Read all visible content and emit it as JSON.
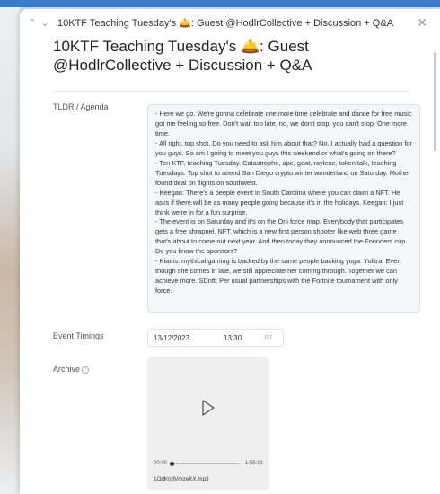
{
  "header": {
    "title": "10KTF Teaching Tuesday's 🛎️: Guest @HodlrCollective + Discussion + Q&A",
    "prev_icon": "chevron-up-icon",
    "next_icon": "chevron-down-icon",
    "close_icon": "close-icon"
  },
  "page": {
    "title": "10KTF Teaching Tuesday's 🛎️: Guest @HodlrCollective + Discussion + Q&A"
  },
  "fields": {
    "tldr_label": "TLDR / Agenda",
    "tldr_text": "- Here we go. We're gonna celebrate one more time celebrate and dance for free music got me feeling so free. Don't wait too late, no, we don't stop, you can't stop. One more time.\n- All right, top shot. Do you need to ask him about that? No, I actually had a question for you guys. So am I going to meet you guys this weekend or what's going on there?\n- Ten KTF, teaching Tuesday. Catastrophe, ape, goat, raylene, token talk, teaching Tuesdays. Top shot to attend San Diego crypto winter wonderland on Saturday. Mother found deal on flights on southwest.\n- Keegan: There's a beeple event in South Carolina where you can claim a NFT. He asks if there will be as many people going because it's in the holidays. Keegan: I just think we're in for a fun surprise.\n- The event is on Saturday and it's on the Oni force map. Everybody that participates gets a free shrapnel, NFT, which is a new first person shooter like web three game that's about to come out next year. And then today they announced the Founders cup. Do you know the sponsors?\n- Kiatris: mythical gaming is backed by the same people backing yuga. Yulitra: Even though she comes in late, we still appreciate her coming through. Together we can achieve more. SDnft: Per usual partnerships with the Fortnite tournament with only force.",
    "timings_label": "Event Timings",
    "date": "13/12/2023",
    "time": "13:30",
    "timezone": "IST",
    "archive_label": "Archive",
    "archive_info_icon": "info-icon"
  },
  "audio": {
    "current_time": "00:00",
    "duration": "1:55:01",
    "progress": 0,
    "file_name": "1OdKrjdVmzeKX.mp3",
    "play_icon": "play-icon"
  }
}
